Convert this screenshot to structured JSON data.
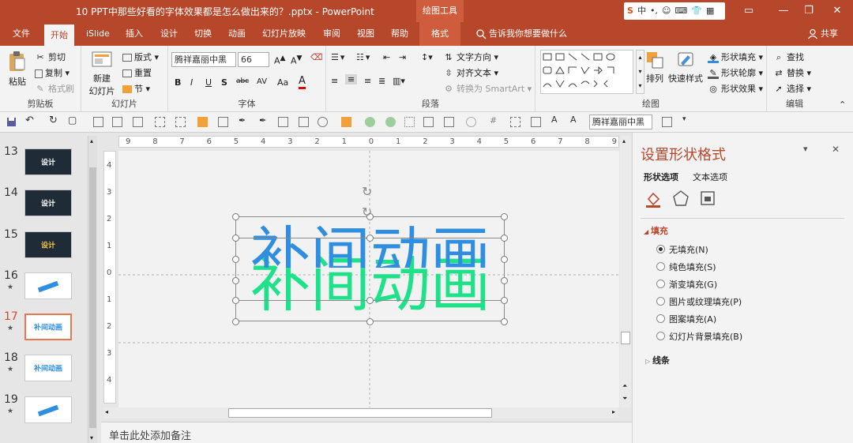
{
  "titlebar": {
    "title": "10 PPT中那些好看的字体效果都是怎么做出来的？.pptx  -  PowerPoint",
    "context_tab": "绘图工具",
    "ime": [
      "S",
      "中",
      "•,",
      "☺",
      "⌨",
      "👕",
      "▦"
    ],
    "min": "—",
    "restore": "❐",
    "close": "✕",
    "ribbon_opts": "▭"
  },
  "tabs": [
    "文件",
    "开始",
    "iSlide",
    "插入",
    "设计",
    "切换",
    "动画",
    "幻灯片放映",
    "审阅",
    "视图",
    "帮助",
    "格式"
  ],
  "tell_me": "告诉我你想要做什么",
  "share": "共享",
  "ribbon": {
    "clipboard": {
      "paste": "粘贴",
      "cut": "剪切",
      "copy": "复制",
      "format_painter": "格式刷",
      "label": "剪贴板"
    },
    "slides": {
      "new_slide_1": "新建",
      "new_slide_2": "幻灯片",
      "layout": "版式",
      "reset": "重置",
      "section": "节",
      "label": "幻灯片"
    },
    "font": {
      "font_name": "腾祥嘉丽中黑",
      "font_size": "66",
      "bold": "B",
      "italic": "I",
      "underline": "U",
      "shadow": "S",
      "strike": "abc",
      "spacing": "AV",
      "case": "Aa",
      "color": "A",
      "label": "字体"
    },
    "paragraph": {
      "text_direction": "文字方向",
      "align_text": "对齐文本",
      "smartart": "转换为 SmartArt",
      "label": "段落"
    },
    "drawing": {
      "arrange": "排列",
      "quick_styles": "快速样式",
      "shape_fill": "形状填充",
      "shape_outline": "形状轮廓",
      "shape_effects": "形状效果",
      "label": "绘图"
    },
    "editing": {
      "find": "查找",
      "replace": "替换",
      "select": "选择",
      "label": "编辑"
    }
  },
  "qat": {
    "font_name": "腾祥嘉丽中黑"
  },
  "slides": [
    {
      "num": "13",
      "text": "设计",
      "bg": "#1f2b36",
      "fg": "#ffffff",
      "star": ""
    },
    {
      "num": "14",
      "text": "设计",
      "bg": "#1f2b36",
      "fg": "#ffffff",
      "star": ""
    },
    {
      "num": "15",
      "text": "设计",
      "bg": "#1f2b36",
      "fg": "#f4c74b",
      "star": ""
    },
    {
      "num": "16",
      "text": "",
      "bg": "#ffffff",
      "fg": "#2f8ee0",
      "star": "★"
    },
    {
      "num": "17",
      "text": "补间动画",
      "bg": "#ffffff",
      "fg": "#2f8ee0",
      "star": "★"
    },
    {
      "num": "18",
      "text": "补间动画",
      "bg": "#ffffff",
      "fg": "#2f8ee0",
      "star": "★"
    },
    {
      "num": "19",
      "text": "",
      "bg": "#ffffff",
      "fg": "#2f8ee0",
      "star": "★"
    }
  ],
  "ruler": {
    "h": [
      "9",
      "8",
      "7",
      "6",
      "5",
      "4",
      "3",
      "2",
      "1",
      "0",
      "1",
      "2",
      "3",
      "4",
      "5",
      "6",
      "7",
      "8",
      "9"
    ],
    "v": [
      "4",
      "3",
      "2",
      "1",
      "0",
      "1",
      "2",
      "3",
      "4"
    ]
  },
  "slide_text": {
    "blue": "补间动画",
    "green": "补间动画",
    "blue_color": "#2f8ee0",
    "green_color": "#1ee28a"
  },
  "notes": "单击此处添加备注",
  "pane": {
    "title": "设置形状格式",
    "tab_shape": "形状选项",
    "tab_text": "文本选项",
    "fill_section": "填充",
    "options": [
      "无填充(N)",
      "纯色填充(S)",
      "渐变填充(G)",
      "图片或纹理填充(P)",
      "图案填充(A)",
      "幻灯片背景填充(B)"
    ],
    "selected": 0,
    "line_section": "线条",
    "close": "✕",
    "menu": "▾"
  }
}
